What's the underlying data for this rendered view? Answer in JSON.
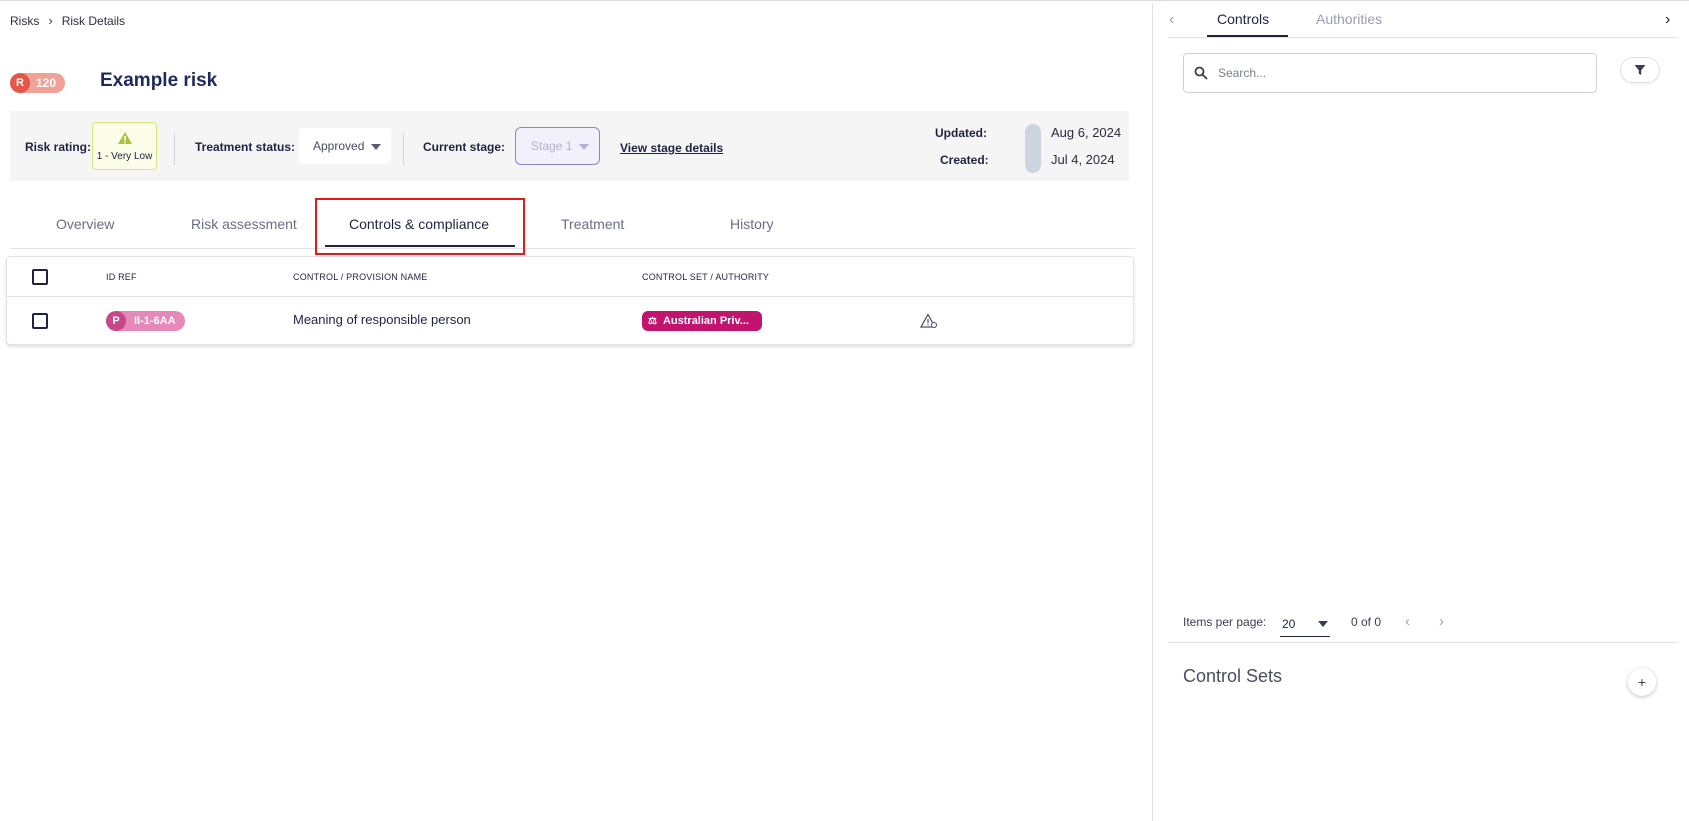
{
  "breadcrumb": {
    "root": "Risks",
    "current": "Risk Details"
  },
  "risk": {
    "badge_letter": "R",
    "badge_number": "120",
    "title": "Example risk"
  },
  "info": {
    "rating_label": "Risk rating:",
    "rating_value": "1 - Very Low",
    "treatment_label": "Treatment status:",
    "treatment_value": "Approved",
    "stage_label": "Current stage:",
    "stage_value": "Stage 1",
    "stage_link": "View stage details",
    "updated_label": "Updated:",
    "updated_value": "Aug 6, 2024",
    "created_label": "Created:",
    "created_value": "Jul 4, 2024"
  },
  "tabs": [
    "Overview",
    "Risk assessment",
    "Controls & compliance",
    "Treatment",
    "History"
  ],
  "active_tab": "Controls & compliance",
  "table": {
    "columns": [
      "ID REF",
      "CONTROL / PROVISION NAME",
      "CONTROL SET / AUTHORITY"
    ],
    "rows": [
      {
        "id_letter": "P",
        "id_ref": "II-1-6AA",
        "name": "Meaning of responsible person",
        "authority": "Australian Priv..."
      }
    ]
  },
  "right_panel": {
    "tabs": [
      "Controls",
      "Authorities"
    ],
    "active_tab": "Controls",
    "search_placeholder": "Search...",
    "items_per_page_label": "Items per page:",
    "items_per_page": "20",
    "range": "0 of 0",
    "control_sets_title": "Control Sets"
  },
  "colors": {
    "accent": "#1f2a5c",
    "risk_badge": "#e3574b",
    "rating_warning": "#a9c33a",
    "authority_chip": "#c2136f",
    "highlight": "#e01b1b"
  }
}
